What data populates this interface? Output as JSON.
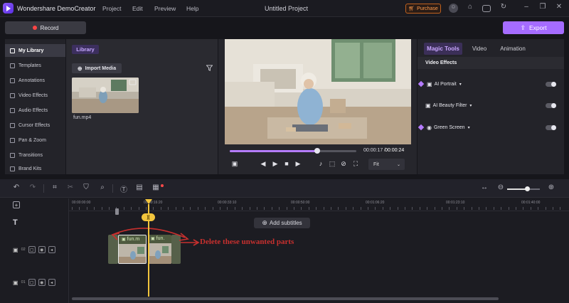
{
  "app": {
    "name": "Wondershare DemoCreator",
    "project_title": "Untitled Project"
  },
  "menu": [
    "Project",
    "Edit",
    "Preview",
    "Help"
  ],
  "titlebar": {
    "purchase_label": "Purchase"
  },
  "toolbar": {
    "record_label": "Record",
    "export_label": "Export"
  },
  "sidebar": {
    "items": [
      {
        "label": "My Library",
        "icon": "layers-icon",
        "active": true
      },
      {
        "label": "Templates",
        "icon": "template-icon"
      },
      {
        "label": "Annotations",
        "icon": "annotation-icon"
      },
      {
        "label": "Video Effects",
        "icon": "video-effects-icon"
      },
      {
        "label": "Audio Effects",
        "icon": "audio-effects-icon"
      },
      {
        "label": "Cursor Effects",
        "icon": "cursor-icon"
      },
      {
        "label": "Pan & Zoom",
        "icon": "pan-zoom-icon"
      },
      {
        "label": "Transitions",
        "icon": "transition-icon"
      },
      {
        "label": "Brand Kits",
        "icon": "brand-kit-icon"
      }
    ]
  },
  "library": {
    "tag": "Library",
    "import_label": "Import Media",
    "media": [
      {
        "name": "fun.mp4"
      }
    ]
  },
  "preview": {
    "current_time": "00:00:17",
    "total_time": "00:00:24",
    "progress": 0.69,
    "fit_option": "Fit"
  },
  "right_panel": {
    "tabs": [
      "Magic Tools",
      "Video",
      "Animation"
    ],
    "active_tab": "Magic Tools",
    "section_title": "Video Effects",
    "items": [
      {
        "label": "AI Portrait",
        "enabled": false
      },
      {
        "label": "AI Beauty Filter",
        "enabled": false
      },
      {
        "label": "Green Screen",
        "enabled": false
      }
    ]
  },
  "timeline": {
    "ruler": [
      "00:00:00:00",
      "00:00:16:20",
      "00:00:33:10",
      "00:00:50:00",
      "00:01:06:20",
      "00:01:23:10",
      "00:01:40:00"
    ],
    "playhead_label": "][",
    "add_subtitles_label": "Add subtitles",
    "tracks": [
      {
        "number": "02"
      },
      {
        "number": "01"
      }
    ],
    "clips": [
      {
        "label": "fun.m"
      },
      {
        "label": "fun."
      }
    ],
    "annotation": "Delete these unwanted parts",
    "zoom_level": 0.6
  },
  "colors": {
    "accent": "#a56cff",
    "playhead": "#f2c53d",
    "annotation": "#c8302e"
  }
}
